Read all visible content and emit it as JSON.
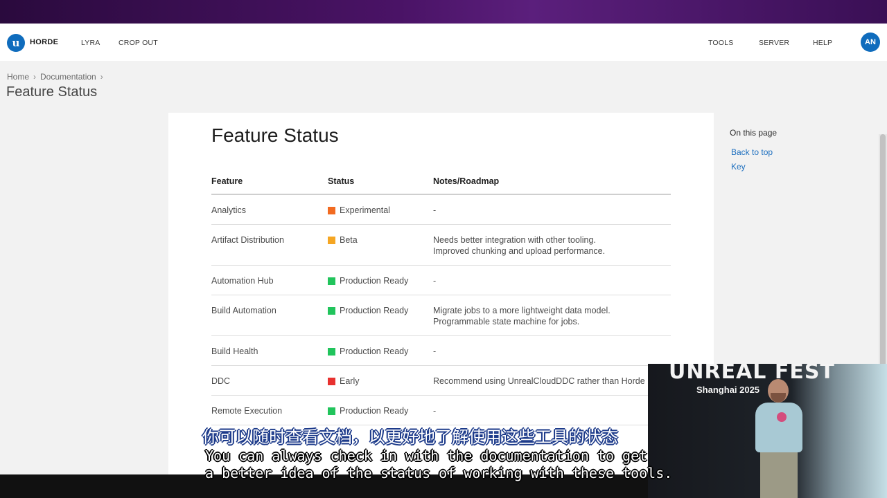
{
  "navbar": {
    "brand": "HORDE",
    "logo_text": "u",
    "left_links": [
      "LYRA",
      "CROP OUT"
    ],
    "right_links": [
      "TOOLS",
      "SERVER",
      "HELP"
    ],
    "avatar_initials": "AN"
  },
  "breadcrumb": {
    "items": [
      "Home",
      "Documentation"
    ],
    "separator": "›"
  },
  "page_heading": "Feature Status",
  "document": {
    "title": "Feature Status",
    "columns": [
      "Feature",
      "Status",
      "Notes/Roadmap"
    ],
    "rows": [
      {
        "feature": "Analytics",
        "status": "Experimental",
        "status_color": "#f26b21",
        "notes": [
          "-"
        ]
      },
      {
        "feature": "Artifact Distribution",
        "status": "Beta",
        "status_color": "#f5a623",
        "notes": [
          "Needs better integration with other tooling.",
          "Improved chunking and upload performance."
        ]
      },
      {
        "feature": "Automation Hub",
        "status": "Production Ready",
        "status_color": "#21c45c",
        "notes": [
          "-"
        ]
      },
      {
        "feature": "Build Automation",
        "status": "Production Ready",
        "status_color": "#21c45c",
        "notes": [
          "Migrate jobs to a more lightweight data model.",
          "Programmable state machine for jobs."
        ]
      },
      {
        "feature": "Build Health",
        "status": "Production Ready",
        "status_color": "#21c45c",
        "notes": [
          "-"
        ]
      },
      {
        "feature": "DDC",
        "status": "Early",
        "status_color": "#e8312f",
        "notes": [
          "Recommend using UnrealCloudDDC rather than Horde"
        ]
      },
      {
        "feature": "Remote Execution",
        "status": "Production Ready",
        "status_color": "#21c45c",
        "notes": [
          "-"
        ]
      }
    ]
  },
  "toc": {
    "heading": "On this page",
    "links": [
      "Back to top",
      "Key"
    ]
  },
  "video": {
    "event_title": "UNREAL FEST",
    "event_subtitle": "Shanghai 2025"
  },
  "subtitles": {
    "chinese": "你可以随时查看文档，以更好地了解使用这些工具的状态",
    "english_line1": "You can always check in with the documentation to get",
    "english_line2": "a better idea of the status of working with these tools."
  },
  "colors": {
    "brand_blue": "#0f6cbd",
    "link_blue": "#1d6fbf",
    "top_band_purple": "#4a1366"
  }
}
